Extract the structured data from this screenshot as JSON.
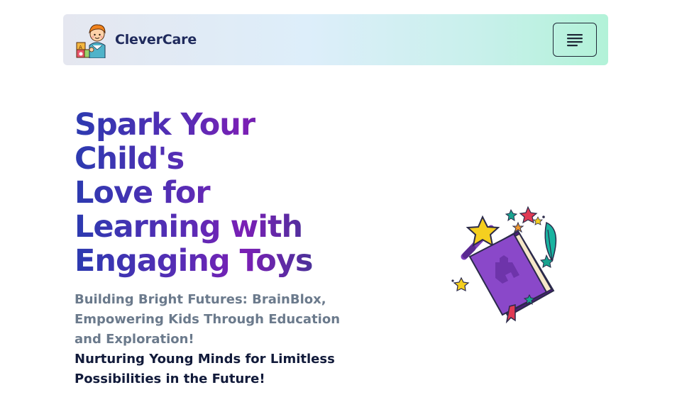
{
  "navbar": {
    "brand_name": "CleverCare",
    "logo_icon": "child-with-toy-blocks-icon",
    "menu_icon": "hamburger-menu-icon"
  },
  "hero": {
    "title_lines": [
      "Spark Your",
      "Child's",
      "Love for",
      "Learning with",
      "Engaging Toys"
    ],
    "subtitle_1": "Building Bright Futures: BrainBlox, Empowering Kids Through Education and Exploration!",
    "subtitle_2": "Nurturing Young Minds for Limitless Possibilities in the Future!",
    "illustration_icon": "magic-storybook-icon"
  },
  "colors": {
    "title_gradient_start": "#2c3ab0",
    "title_gradient_mid": "#7a1fb5",
    "subtitle_muted": "#6b7a8c",
    "subtitle_dark": "#111a3a",
    "navbar_gradient_end": "#b2f2d8"
  }
}
